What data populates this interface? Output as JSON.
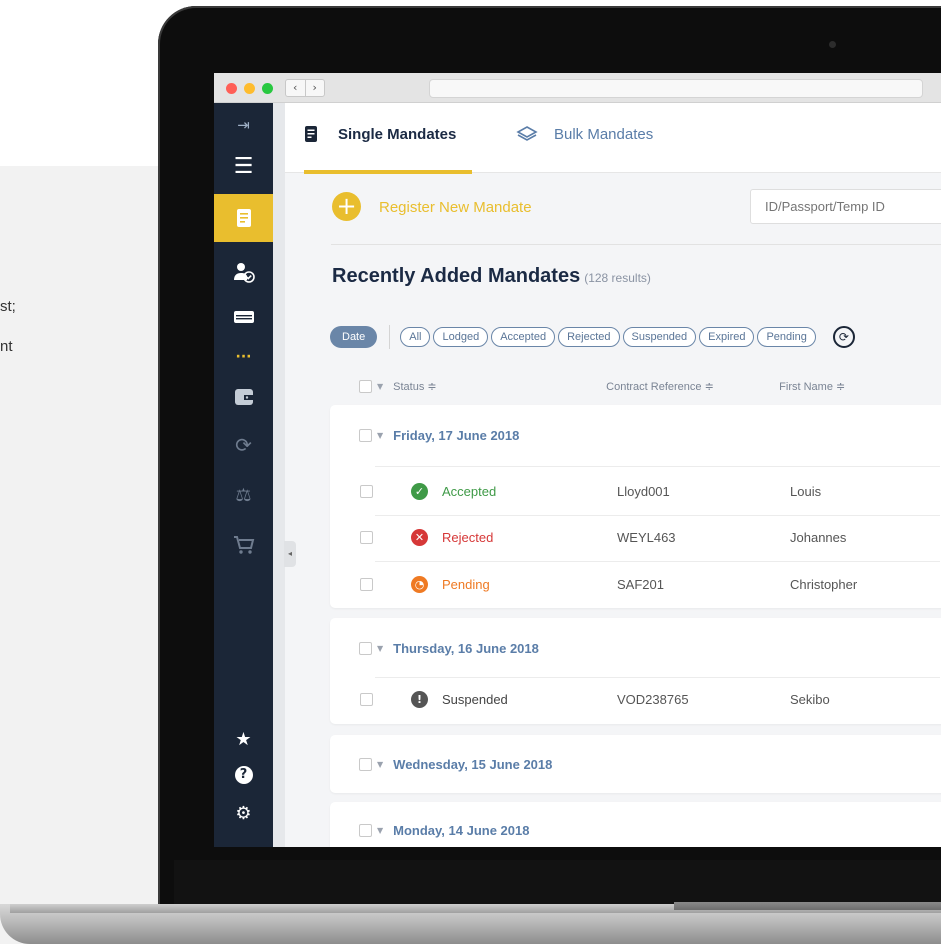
{
  "side_text": [
    "st;",
    "nt"
  ],
  "sidebar": {
    "items": [
      {
        "icon": "login-arrow-icon",
        "glyph": "⇥"
      },
      {
        "icon": "hamburger-menu-icon",
        "glyph": "☰"
      },
      {
        "icon": "document-icon",
        "glyph": "▤"
      },
      {
        "icon": "user-check-icon",
        "glyph": "👤"
      },
      {
        "icon": "card-reader-icon",
        "glyph": "▬"
      },
      {
        "icon": "more-dots-icon",
        "glyph": "···"
      },
      {
        "icon": "wallet-icon",
        "glyph": "▣"
      },
      {
        "icon": "sync-icon",
        "glyph": "⟳"
      },
      {
        "icon": "scales-icon",
        "glyph": "⚖"
      },
      {
        "icon": "cart-icon",
        "glyph": "🛒"
      },
      {
        "icon": "star-icon",
        "glyph": "★"
      },
      {
        "icon": "help-icon",
        "glyph": "?"
      },
      {
        "icon": "settings-search-icon",
        "glyph": "⚙"
      }
    ]
  },
  "tabs": {
    "single": "Single Mandates",
    "bulk": "Bulk Mandates"
  },
  "register": {
    "label": "Register New Mandate"
  },
  "search": {
    "placeholder": "ID/Passport/Temp ID"
  },
  "heading": {
    "title": "Recently Added Mandates",
    "count": "(128 results)"
  },
  "filters": {
    "date": "Date",
    "chips": [
      "All",
      "Lodged",
      "Accepted",
      "Rejected",
      "Suspended",
      "Expired",
      "Pending"
    ]
  },
  "columns": {
    "status": "Status ≑",
    "contract": "Contract Reference ≑",
    "first": "First Name ≑"
  },
  "groups": [
    {
      "date": "Friday, 17 June 2018"
    },
    {
      "date": "Thursday, 16 June 2018"
    },
    {
      "date": "Wednesday, 15 June 2018"
    },
    {
      "date": "Monday, 14 June 2018"
    }
  ],
  "rows": [
    {
      "status": "Accepted",
      "ref": "Lloyd001",
      "first": "Louis"
    },
    {
      "status": "Rejected",
      "ref": "WEYL463",
      "first": "Johannes"
    },
    {
      "status": "Pending",
      "ref": "SAF201",
      "first": "Christopher"
    },
    {
      "status": "Suspended",
      "ref": "VOD238765",
      "first": "Sekibo"
    }
  ],
  "colors": {
    "accent": "#e9be2e",
    "sidebar": "#1b2637",
    "accepted": "#3f9a47",
    "rejected": "#d63838",
    "pending": "#ef7a23",
    "suspended": "#555555",
    "link": "#5a7da8"
  }
}
